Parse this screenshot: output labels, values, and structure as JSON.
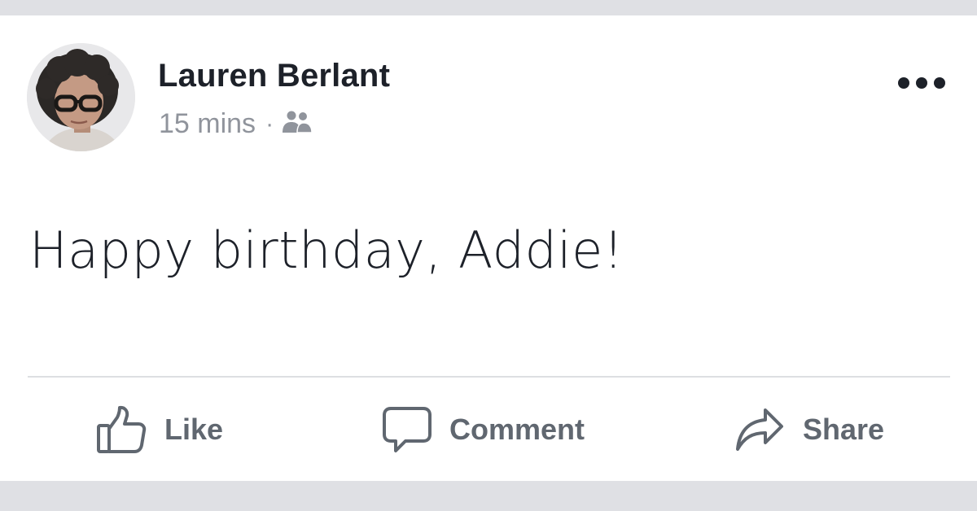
{
  "post": {
    "author": "Lauren Berlant",
    "timestamp": "15 mins",
    "separator": "·",
    "audience_icon": "friends-icon",
    "text": "Happy birthday, Addie!"
  },
  "actions": {
    "like_label": "Like",
    "comment_label": "Comment",
    "share_label": "Share"
  },
  "icons": {
    "more": "more-options-icon",
    "like": "thumbs-up-icon",
    "comment": "speech-bubble-icon",
    "share": "share-arrow-icon"
  },
  "colors": {
    "page_background": "#dfe0e4",
    "card_background": "#ffffff",
    "author_text": "#1d2129",
    "meta_text": "#90949c",
    "action_text": "#606770",
    "divider": "#dddfe2"
  }
}
